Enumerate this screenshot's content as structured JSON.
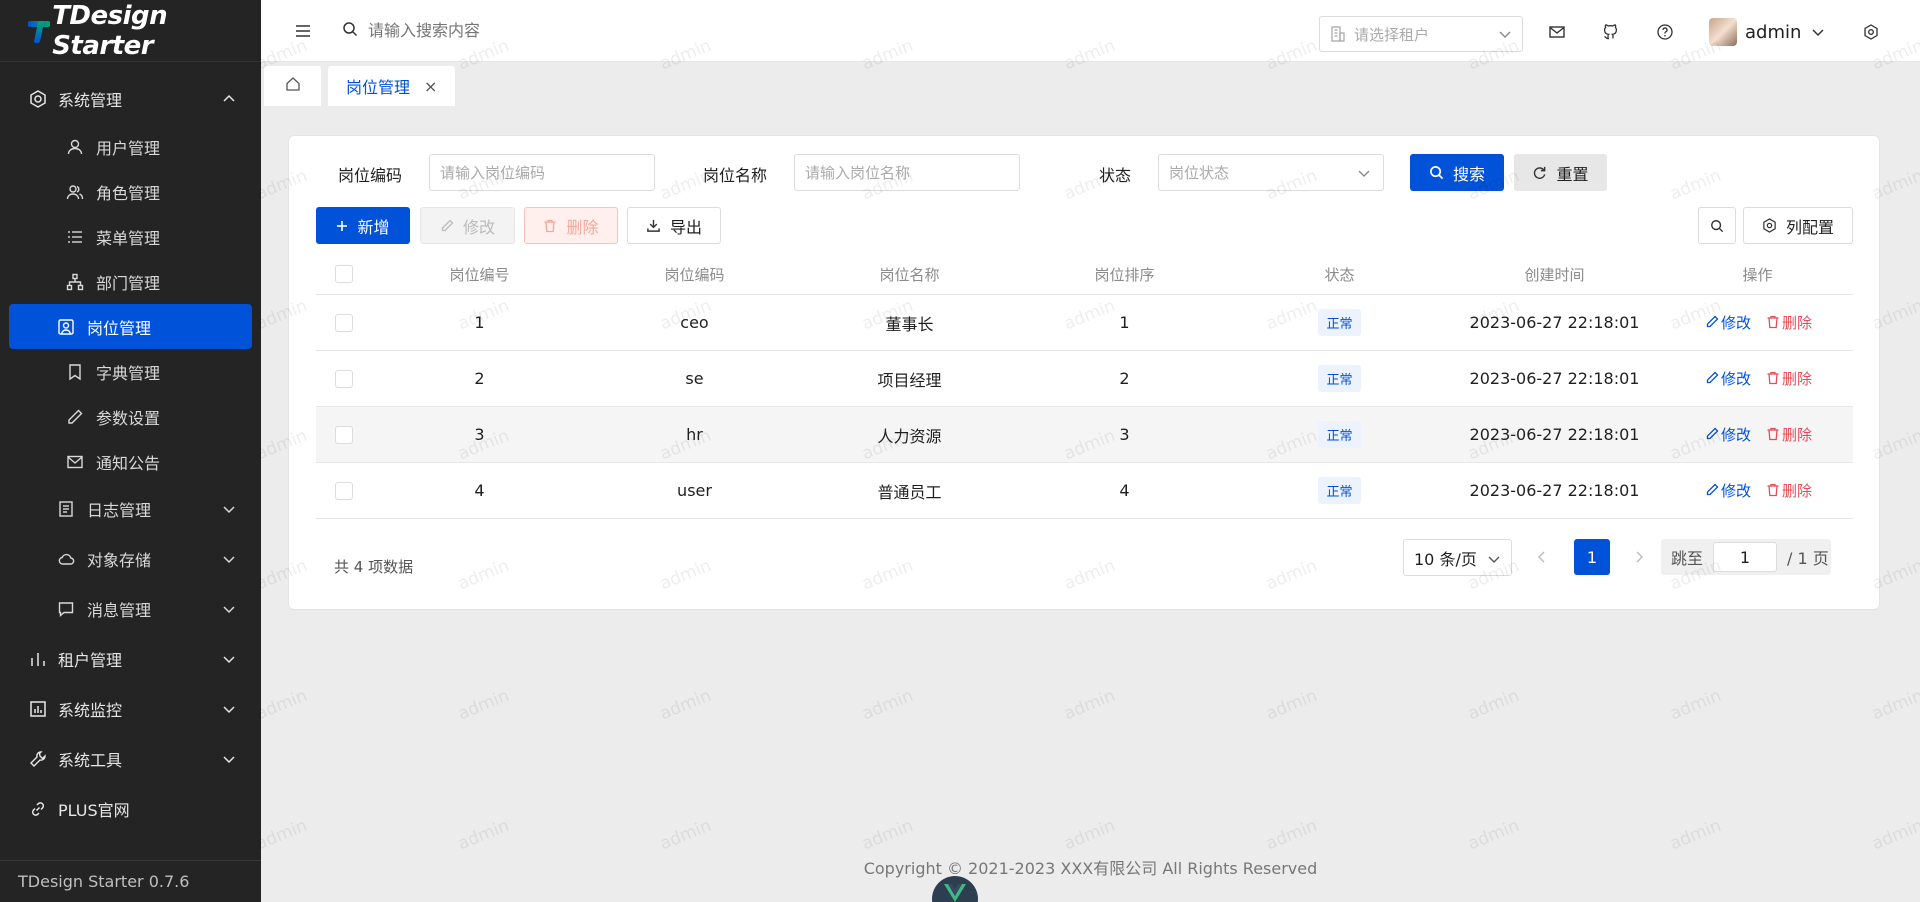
{
  "app": {
    "logo_text": "TDesign Starter",
    "version": "TDesign Starter 0.7.6"
  },
  "colors": {
    "primary": "#0052d9",
    "danger": "#e34d59",
    "sidebar_bg": "#242424"
  },
  "sidebar": {
    "group_system": "系统管理",
    "items": [
      {
        "label": "用户管理",
        "icon": "user-icon"
      },
      {
        "label": "角色管理",
        "icon": "users-icon"
      },
      {
        "label": "菜单管理",
        "icon": "menu-list-icon"
      },
      {
        "label": "部门管理",
        "icon": "org-icon"
      },
      {
        "label": "岗位管理",
        "icon": "user-card-icon",
        "active": true
      },
      {
        "label": "字典管理",
        "icon": "bookmark-icon"
      },
      {
        "label": "参数设置",
        "icon": "pen-icon"
      },
      {
        "label": "通知公告",
        "icon": "mail-icon"
      }
    ],
    "subgroups": [
      {
        "label": "日志管理",
        "icon": "log-icon"
      },
      {
        "label": "对象存储",
        "icon": "cloud-icon"
      },
      {
        "label": "消息管理",
        "icon": "chat-icon"
      }
    ],
    "groups": [
      {
        "label": "租户管理",
        "icon": "chart-bar-icon"
      },
      {
        "label": "系统监控",
        "icon": "monitor-icon"
      },
      {
        "label": "系统工具",
        "icon": "wrench-icon"
      }
    ],
    "link_plus": "PLUS官网"
  },
  "header": {
    "search_placeholder": "请输入搜索内容",
    "tenant_placeholder": "请选择租户",
    "username": "admin"
  },
  "tabs": {
    "active_label": "岗位管理",
    "close": "×"
  },
  "filters": {
    "code_label": "岗位编码",
    "code_placeholder": "请输入岗位编码",
    "name_label": "岗位名称",
    "name_placeholder": "请输入岗位名称",
    "status_label": "状态",
    "status_placeholder": "岗位状态",
    "search_btn": "搜索",
    "reset_btn": "重置"
  },
  "toolbar": {
    "add": "新增",
    "edit": "修改",
    "delete": "删除",
    "export": "导出",
    "columns": "列配置"
  },
  "table": {
    "headers": [
      "岗位编号",
      "岗位编码",
      "岗位名称",
      "岗位排序",
      "状态",
      "创建时间",
      "操作"
    ],
    "rows": [
      {
        "id": "1",
        "code": "ceo",
        "name": "董事长",
        "sort": "1",
        "status": "正常",
        "created": "2023-06-27 22:18:01"
      },
      {
        "id": "2",
        "code": "se",
        "name": "项目经理",
        "sort": "2",
        "status": "正常",
        "created": "2023-06-27 22:18:01"
      },
      {
        "id": "3",
        "code": "hr",
        "name": "人力资源",
        "sort": "3",
        "status": "正常",
        "created": "2023-06-27 22:18:01"
      },
      {
        "id": "4",
        "code": "user",
        "name": "普通员工",
        "sort": "4",
        "status": "正常",
        "created": "2023-06-27 22:18:01"
      }
    ],
    "op_edit": "修改",
    "op_delete": "删除"
  },
  "pagination": {
    "total_text": "共 4 项数据",
    "page_size": "10 条/页",
    "current": "1",
    "jump_label": "跳至",
    "jump_value": "1",
    "pages_text": "/ 1 页"
  },
  "footer": {
    "copyright": "Copyright © 2021-2023 XXX有限公司 All Rights Reserved"
  },
  "watermark": "admin"
}
